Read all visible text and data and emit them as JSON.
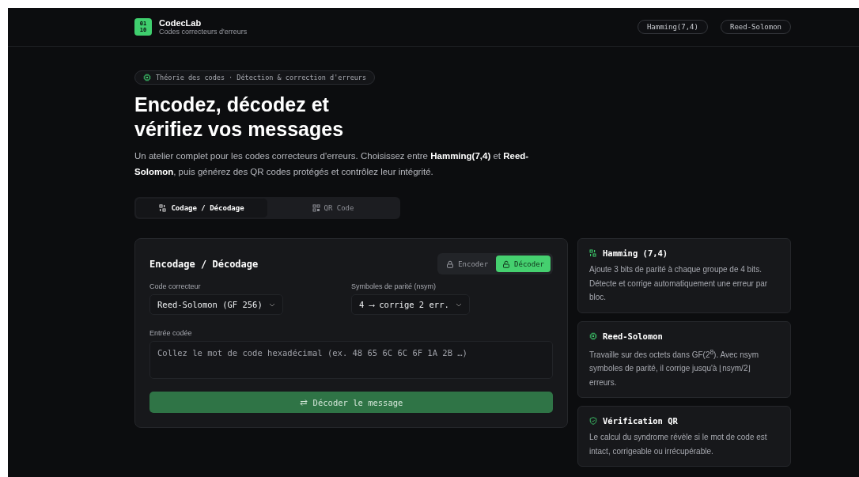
{
  "header": {
    "logo": [
      "01",
      "10"
    ],
    "title": "CodecLab",
    "subtitle": "Codes correcteurs d'erreurs",
    "chips": [
      "Hamming(7,4)",
      "Reed-Solomon"
    ]
  },
  "hero": {
    "badge": "Théorie des codes · Détection & correction d'erreurs",
    "title_lines": [
      "Encodez, décodez et",
      "vérifiez vos messages"
    ],
    "lead": "Un atelier complet pour les codes correcteurs d'erreurs. Choisissez entre **Hamming(7,4)** et **Reed-Solomon**, puis générez des QR codes protégés et contrôlez leur intégrité."
  },
  "tabs": [
    {
      "label": "Codage / Décodage",
      "kind": "bits",
      "selected": true
    },
    {
      "label": "QR Code",
      "kind": "qr",
      "selected": false
    }
  ],
  "panel": {
    "title": "Encodage / Décodage",
    "modes": [
      {
        "label": "Encoder",
        "selected": false
      },
      {
        "label": "Décoder",
        "selected": true
      }
    ],
    "selects": [
      {
        "label": "Code correcteur",
        "value": "Reed-Solomon (GF 256)"
      },
      {
        "label": "Symboles de parité (nsym)",
        "value": "4 ⟶ corrige 2 err."
      }
    ],
    "input": {
      "label": "Entrée codée",
      "placeholder": "Collez le mot de code hexadécimal (ex. 48 65 6C 6C 6F 1A 2B …)"
    },
    "action": "Décoder le message"
  },
  "info_cards": [
    {
      "kind": "bits",
      "title": "Hamming (7,4)",
      "text": "Ajoute 3 bits de parité à chaque groupe de 4 bits. Détecte et corrige automatiquement une erreur par bloc."
    },
    {
      "kind": "chip",
      "title": "Reed-Solomon",
      "text": "Travaille sur des octets dans GF(2$^{8}$). Avec nsym symboles de parité, il corrige jusqu'à ⌊nsym/2⌋ erreurs."
    },
    {
      "kind": "shield",
      "title": "Vérification QR",
      "text": "Le calcul du syndrome révèle si le mot de code est intact, corrigeable ou irrécupérable."
    }
  ]
}
